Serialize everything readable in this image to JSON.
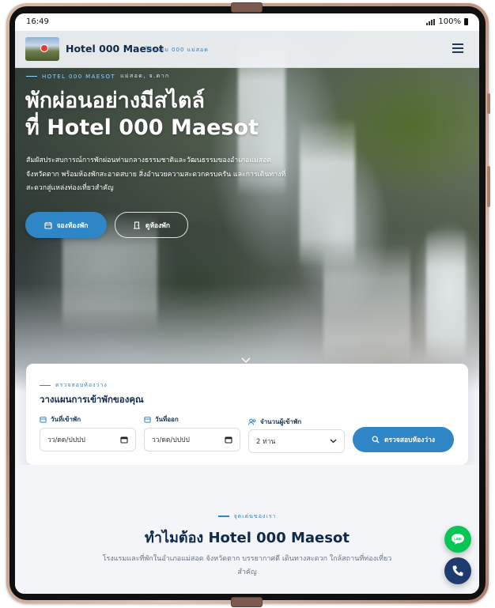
{
  "status_bar": {
    "time": "16:49",
    "battery": "100%"
  },
  "navbar": {
    "brand": "Hotel 000 Maesot",
    "brand_sub": "โรงแรม 000 แม่สอด",
    "menu_icon": "hamburger-icon"
  },
  "hero": {
    "eyebrow": "HOTEL 000 MAESOT",
    "location": "แม่สอด, จ.ตาก",
    "title_line1": "พักผ่อนอย่างมีสไตล์",
    "title_line2": "ที่ Hotel 000 Maesot",
    "lead": "สัมผัสประสบการณ์การพักผ่อนท่ามกลางธรรมชาติและวัฒนธรรมของอำเภอแม่สอด จังหวัดตาก พร้อมห้องพักสะอาดสบาย สิ่งอำนวยความสะดวกครบครัน และการเดินทางที่สะดวกสู่แหล่งท่องเที่ยวสำคัญ",
    "primary_button": "จองห้องพัก",
    "secondary_button": "ดูห้องพัก"
  },
  "booking": {
    "eyebrow": "ตรวจสอบห้องว่าง",
    "title": "วางแผนการเข้าพักของคุณ",
    "checkin_label": "วันที่เข้าพัก",
    "checkin_placeholder": "วว/ดด/ปปปป",
    "checkout_label": "วันที่ออก",
    "checkout_placeholder": "วว/ดด/ปปปป",
    "guests_label": "จำนวนผู้เข้าพัก",
    "guests_value": "2 ท่าน",
    "search_button": "ตรวจสอบห้องว่าง"
  },
  "features": {
    "eyebrow": "จุดเด่นของเรา",
    "title": "ทำไมต้อง Hotel 000 Maesot",
    "desc": "โรงแรมและที่พักในอำเภอแม่สอด จังหวัดตาก บรรยากาศดี เดินทางสะดวก ใกล้สถานที่ท่องเที่ยวสำคัญ"
  },
  "fabs": {
    "line_label": "LINE",
    "line_icon": "line-chat-icon",
    "phone_icon": "phone-icon"
  },
  "colors": {
    "accent": "#2f86c6",
    "navy": "#0f2a4a",
    "line_green": "#06c755",
    "phone_navy": "#1e3a6e"
  }
}
